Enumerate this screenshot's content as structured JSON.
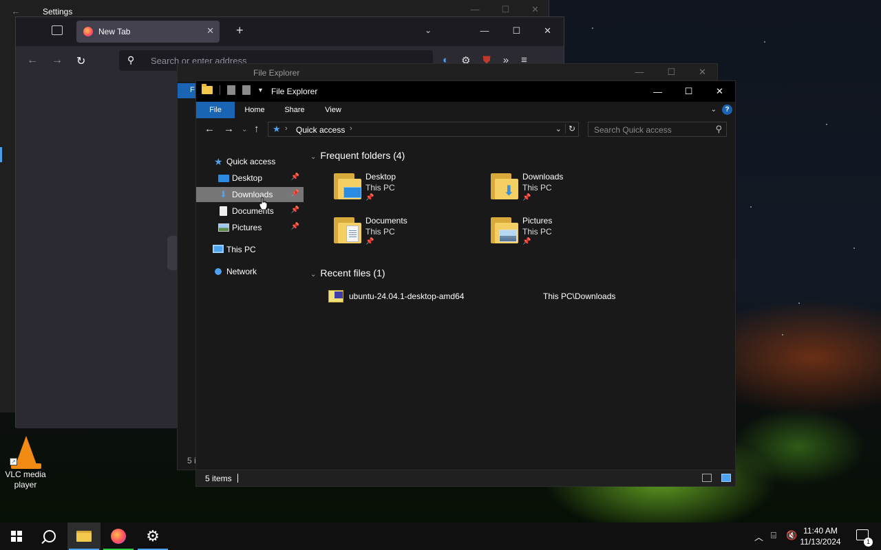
{
  "settings": {
    "title": "Settings"
  },
  "browser": {
    "tab_label": "New Tab",
    "address_placeholder": "Search or enter address"
  },
  "explorer_back": {
    "title": "File Explorer",
    "ribbon_file": "F",
    "status": "5 i"
  },
  "explorer": {
    "title": "File Explorer",
    "ribbon_tabs": [
      "File",
      "Home",
      "Share",
      "View"
    ],
    "path": "Quick access",
    "search_placeholder": "Search Quick access",
    "nav": {
      "quick_access": "Quick access",
      "desktop": "Desktop",
      "downloads": "Downloads",
      "documents": "Documents",
      "pictures": "Pictures",
      "this_pc": "This PC",
      "network": "Network"
    },
    "frequent_header": "Frequent folders (4)",
    "folders": [
      {
        "name": "Desktop",
        "location": "This PC"
      },
      {
        "name": "Downloads",
        "location": "This PC"
      },
      {
        "name": "Documents",
        "location": "This PC"
      },
      {
        "name": "Pictures",
        "location": "This PC"
      }
    ],
    "recent_header": "Recent files (1)",
    "recent_files": [
      {
        "name": "ubuntu-24.04.1-desktop-amd64",
        "path": "This PC\\Downloads"
      }
    ],
    "status": "5 items"
  },
  "desktop": {
    "vlc_label": "VLC media player"
  },
  "taskbar": {
    "time": "11:40 AM",
    "date": "11/13/2024",
    "notification_count": "1"
  },
  "colors": {
    "accent": "#1a64b4",
    "selection": "#777777",
    "folder": "#f4cf64"
  }
}
